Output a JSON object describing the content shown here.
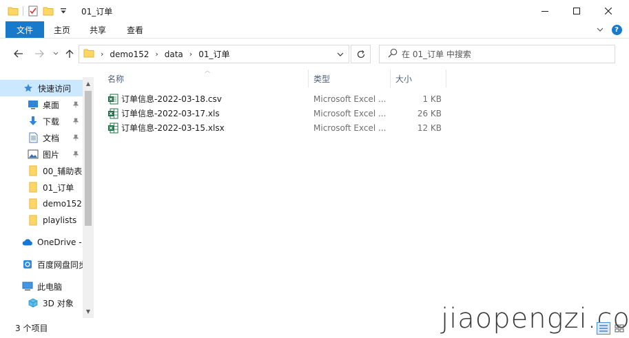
{
  "window": {
    "title": "01_订单"
  },
  "ribbon": {
    "tabs": [
      "文件",
      "主页",
      "共享",
      "查看"
    ],
    "help": "?"
  },
  "address": {
    "crumbs": [
      "demo152",
      "data",
      "01_订单"
    ]
  },
  "search": {
    "placeholder": "在 01_订单 中搜索"
  },
  "nav": {
    "items": [
      {
        "label": "快速访问",
        "icon": "star-icon",
        "pinned": false
      },
      {
        "label": "桌面",
        "icon": "desktop-icon",
        "pinned": true
      },
      {
        "label": "下载",
        "icon": "download-arrow-icon",
        "pinned": true
      },
      {
        "label": "文档",
        "icon": "document-icon",
        "pinned": true
      },
      {
        "label": "图片",
        "icon": "picture-icon",
        "pinned": true
      },
      {
        "label": "00_辅助表",
        "icon": "folder-icon",
        "pinned": false
      },
      {
        "label": "01_订单",
        "icon": "folder-icon",
        "pinned": false
      },
      {
        "label": "demo152",
        "icon": "folder-icon",
        "pinned": false
      },
      {
        "label": "playlists",
        "icon": "folder-icon",
        "pinned": false
      },
      {
        "label": "OneDrive -",
        "icon": "cloud-icon",
        "pinned": false
      },
      {
        "label": "百度网盘同步",
        "icon": "baidu-sync-icon",
        "pinned": false
      },
      {
        "label": "此电脑",
        "icon": "computer-icon",
        "pinned": false
      },
      {
        "label": "3D 对象",
        "icon": "3d-objects-icon",
        "pinned": false
      }
    ]
  },
  "filelist": {
    "columns": {
      "name": "名称",
      "type": "类型",
      "size": "大小"
    },
    "rows": [
      {
        "name": "订单信息-2022-03-18.csv",
        "type": "Microsoft Excel ...",
        "size": "1 KB",
        "icon": "excel-csv-icon"
      },
      {
        "name": "订单信息-2022-03-17.xls",
        "type": "Microsoft Excel ...",
        "size": "26 KB",
        "icon": "excel-xls-icon"
      },
      {
        "name": "订单信息-2022-03-15.xlsx",
        "type": "Microsoft Excel ...",
        "size": "12 KB",
        "icon": "excel-xlsx-icon"
      }
    ]
  },
  "status": {
    "count": "3 个项目"
  },
  "watermark": "jiaopengzi.com",
  "colors": {
    "accent": "#1979ca",
    "selected": "#cce8ff",
    "folder": "#ffd766",
    "excel": "#1d6f42"
  }
}
